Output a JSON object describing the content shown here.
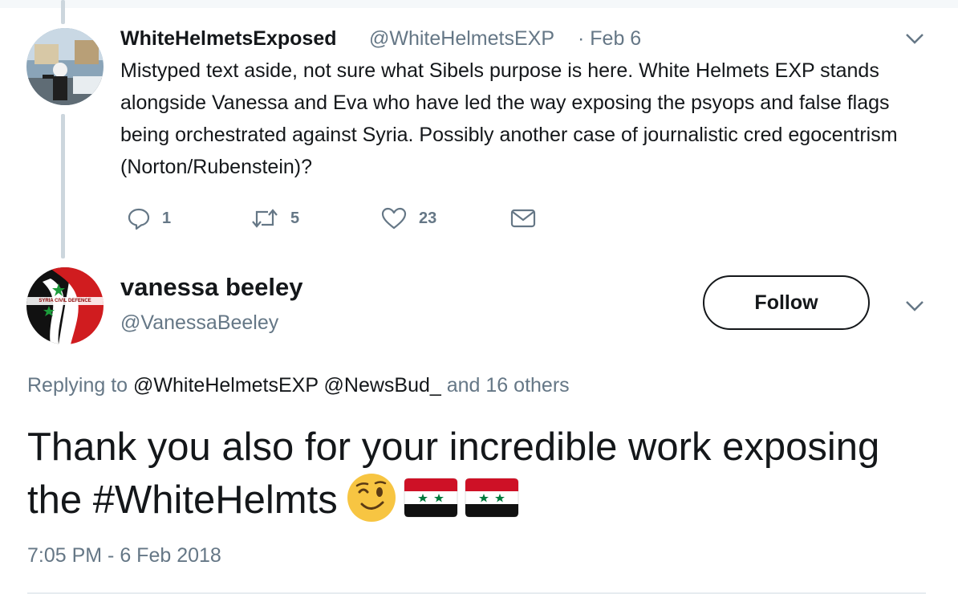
{
  "prev_tweet": {
    "display_name": "WhiteHelmetsExposed",
    "handle": "@WhiteHelmetsEXP",
    "date": "· Feb 6",
    "text": "Mistyped text aside, not sure what Sibels purpose is here. White Helmets EXP stands alongside Vanessa and Eva who have led the way exposing the psyops and false flags being orchestrated against Syria. Possibly another case of journalistic cred egocentrism (Norton/Rubenstein)?",
    "actions": {
      "reply_count": "1",
      "retweet_count": "5",
      "like_count": "23"
    }
  },
  "main_tweet": {
    "display_name": "vanessa beeley",
    "handle": "@VanessaBeeley",
    "follow_label": "Follow",
    "replying_prefix": "Replying to",
    "replying_to": "@WhiteHelmetsEXP @NewsBud_",
    "replying_suffix": "and 16 others",
    "text": "Thank you also for your incredible work exposing the #WhiteHelmts",
    "emojis": [
      "winking-face",
      "syria-flag",
      "syria-flag"
    ],
    "timestamp": "7:05 PM - 6 Feb 2018",
    "avatar_badge": "SYRIA CIVIL DEFENCE"
  },
  "colors": {
    "text": "#14171a",
    "muted": "#657786",
    "thread_line": "#ccd6dd",
    "flag_red": "#ce1126",
    "flag_green": "#007a3d"
  }
}
